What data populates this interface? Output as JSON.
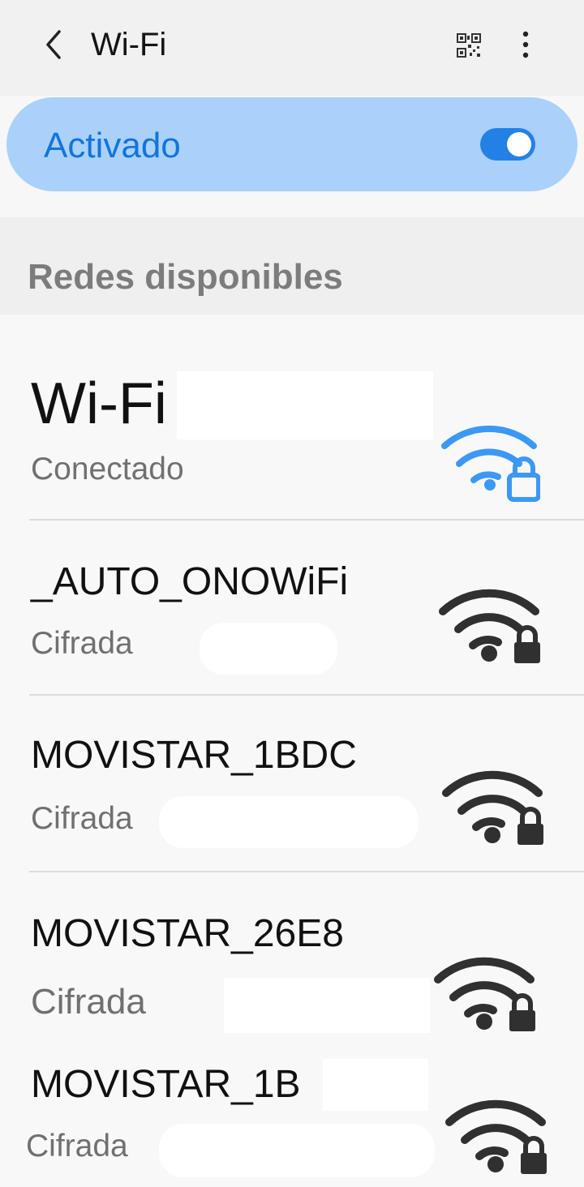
{
  "header": {
    "title": "Wi-Fi",
    "back_icon": "chevron-left-icon",
    "qr_icon": "qr-code-icon",
    "more_icon": "more-vertical-icon"
  },
  "wifi_toggle": {
    "label": "Activado",
    "state": "on",
    "accent_color": "#1474d8",
    "card_color": "#a9d1fa"
  },
  "available": {
    "title": "Redes disponibles"
  },
  "networks": [
    {
      "name": "Wi-Fi",
      "status": "Conectado",
      "icon": "wifi-lock-icon",
      "signal_color": "#3c98f5"
    },
    {
      "name": "_AUTO_ONOWiFi",
      "status": "Cifrada",
      "icon": "wifi-lock-icon",
      "signal_color": "#303030"
    },
    {
      "name": "MOVISTAR_1BDC",
      "status": "Cifrada",
      "icon": "wifi-lock-icon",
      "signal_color": "#303030"
    },
    {
      "name": "MOVISTAR_26E8",
      "status": "Cifrada",
      "icon": "wifi-lock-icon",
      "signal_color": "#303030"
    },
    {
      "name": "MOVISTAR_1B",
      "status": "Cifrada",
      "icon": "wifi-lock-icon",
      "signal_color": "#303030"
    }
  ]
}
